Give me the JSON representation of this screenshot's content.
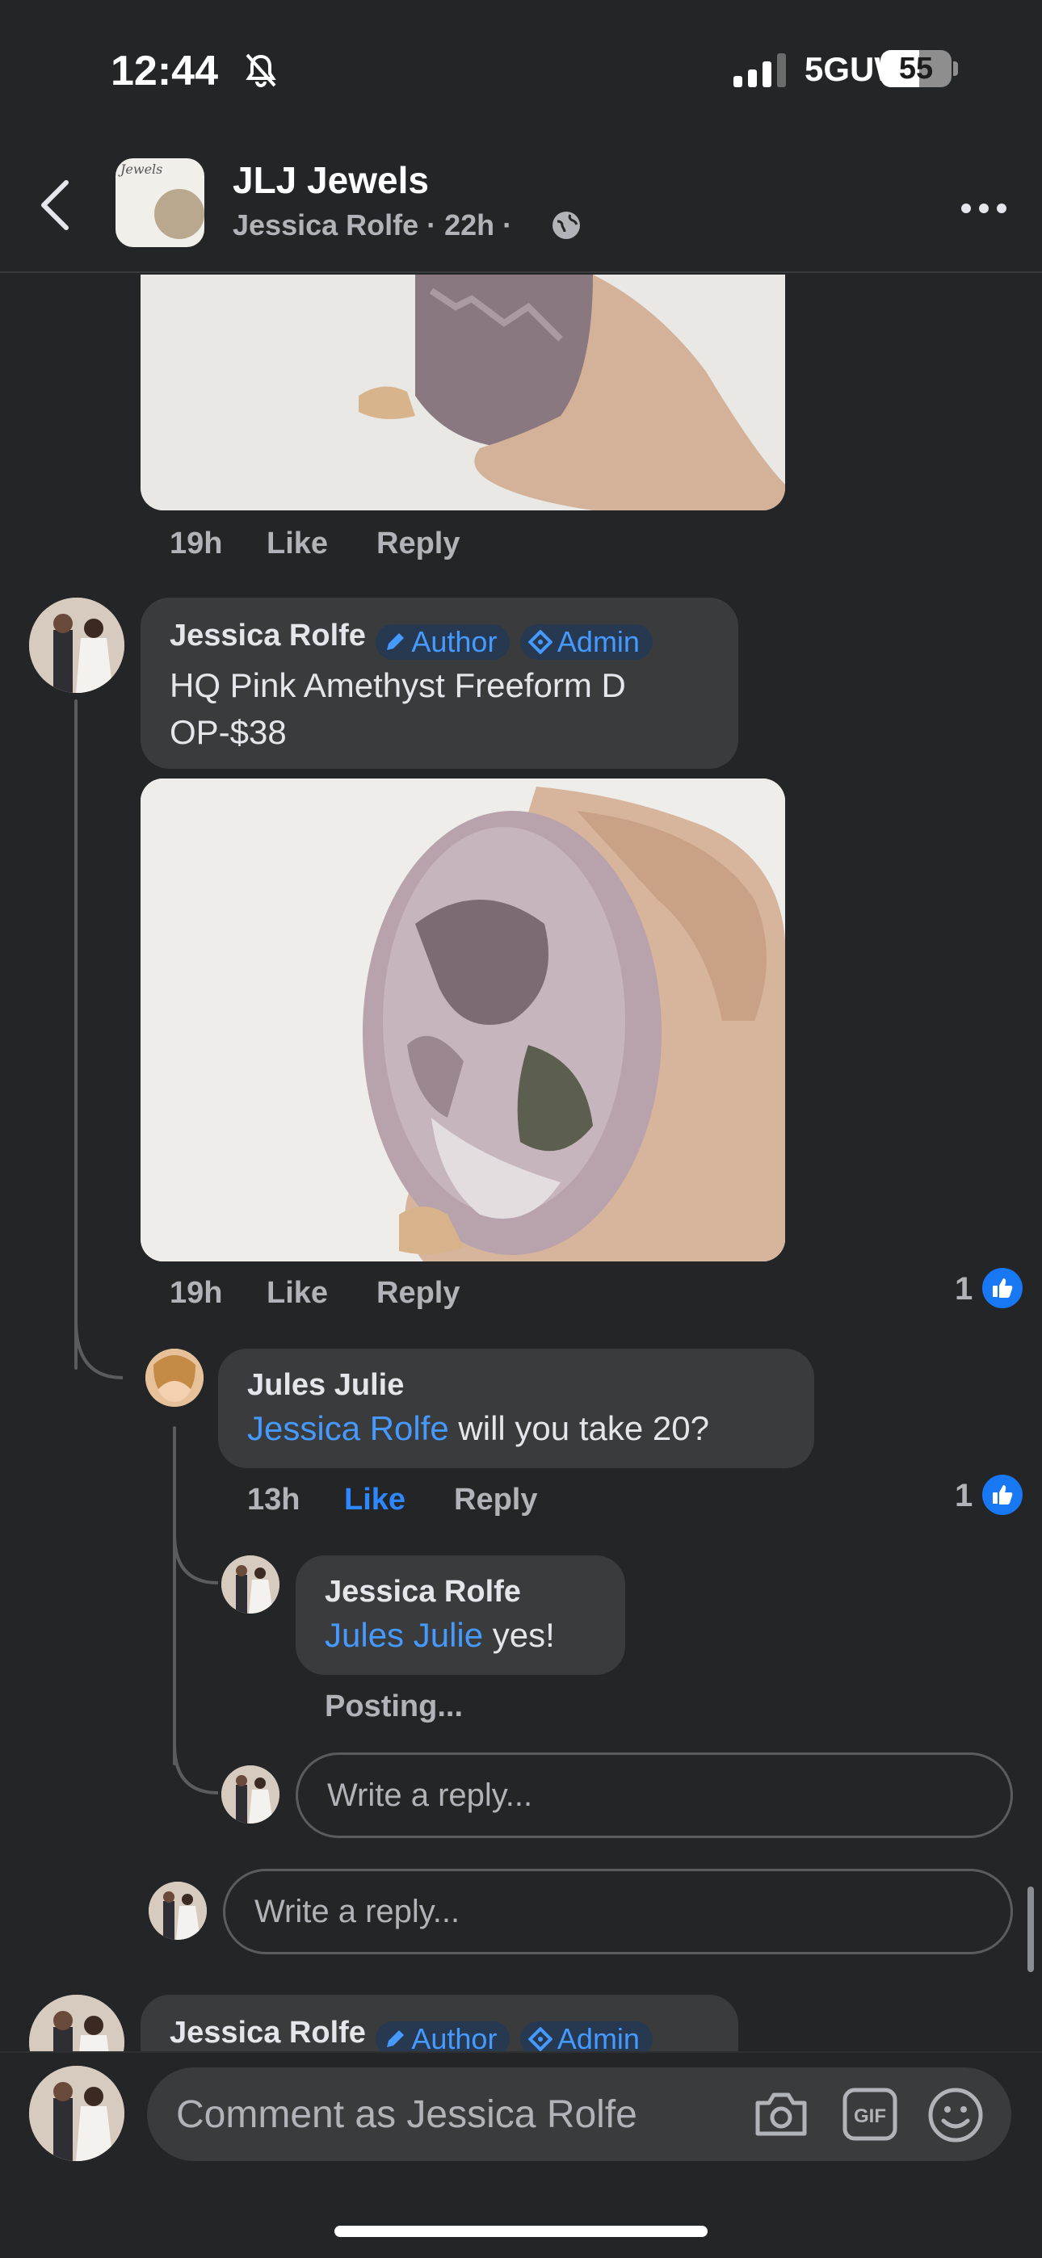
{
  "status_bar": {
    "time": "12:44",
    "network": "5GUW",
    "battery": "55"
  },
  "header": {
    "title": "JLJ Jewels",
    "subtitle": "Jessica Rolfe · 22h ·",
    "group_avatar_text": "Jewels"
  },
  "top_comment": {
    "time": "19h",
    "like": "Like",
    "reply": "Reply"
  },
  "comment1": {
    "author": "Jessica Rolfe",
    "badge_author": "Author",
    "badge_admin": "Admin",
    "text": "HQ Pink Amethyst Freeform D OP-$38",
    "time": "19h",
    "like": "Like",
    "reply": "Reply",
    "like_count": "1"
  },
  "reply1": {
    "author": "Jules Julie",
    "mention": "Jessica Rolfe",
    "text": " will you take 20?",
    "time": "13h",
    "like": "Like",
    "reply": "Reply",
    "like_count": "1"
  },
  "reply2": {
    "author": "Jessica Rolfe",
    "mention": "Jules Julie",
    "text": " yes!",
    "status": "Posting..."
  },
  "reply_input_nested": {
    "placeholder": "Write a reply..."
  },
  "reply_input_thread": {
    "placeholder": "Write a reply..."
  },
  "next_comment": {
    "author": "Jessica Rolfe",
    "badge_author": "Author",
    "badge_admin": "Admin"
  },
  "composer": {
    "placeholder": "Comment as Jessica Rolfe"
  },
  "colors": {
    "background": "#242526",
    "bubble": "#3a3b3c",
    "accent": "#2d88ff",
    "badge_bg": "#263951"
  }
}
